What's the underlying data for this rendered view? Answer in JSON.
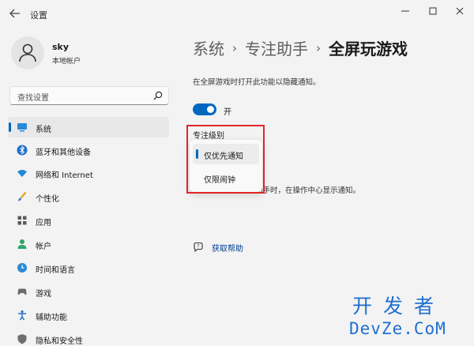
{
  "window": {
    "title": "设置",
    "back_icon": "back-arrow-icon",
    "controls": [
      "minimize-icon",
      "maximize-icon",
      "close-icon"
    ]
  },
  "profile": {
    "name": "sky",
    "account_type": "本地帐户",
    "avatar_icon": "user-silhouette-icon"
  },
  "search": {
    "placeholder": "查找设置",
    "icon": "search-icon"
  },
  "sidebar": {
    "items": [
      {
        "label": "系统",
        "icon": "monitor-icon",
        "selected": true
      },
      {
        "label": "蓝牙和其他设备",
        "icon": "bluetooth-icon"
      },
      {
        "label": "网络和 Internet",
        "icon": "wifi-icon"
      },
      {
        "label": "个性化",
        "icon": "brush-icon"
      },
      {
        "label": "应用",
        "icon": "apps-grid-icon"
      },
      {
        "label": "帐户",
        "icon": "account-icon"
      },
      {
        "label": "时间和语言",
        "icon": "clock-globe-icon"
      },
      {
        "label": "游戏",
        "icon": "gamepad-icon"
      },
      {
        "label": "辅助功能",
        "icon": "accessibility-icon"
      },
      {
        "label": "隐私和安全性",
        "icon": "shield-icon"
      }
    ]
  },
  "breadcrumb": {
    "items": [
      "系统",
      "专注助手",
      "全屏玩游戏"
    ],
    "separator": "›"
  },
  "content": {
    "description": "在全屏游戏时打开此功能以隐藏通知。",
    "toggle": {
      "state": "on",
      "label": "开"
    },
    "focus_level_label": "专注级别",
    "focus_options": [
      {
        "label": "仅优先通知",
        "selected": true
      },
      {
        "label": "仅限闹钟",
        "selected": false
      }
    ],
    "obscured_text": "自动打开专注助手时，在操作中心显示通知。",
    "help_link": "获取帮助",
    "help_icon": "help-chat-icon"
  },
  "watermark": {
    "chinese": "开发者",
    "english": "DevZe.CoM"
  },
  "colors": {
    "accent": "#0067c0",
    "highlight_box": "#e0262a",
    "watermark": "#1e6fd0"
  }
}
